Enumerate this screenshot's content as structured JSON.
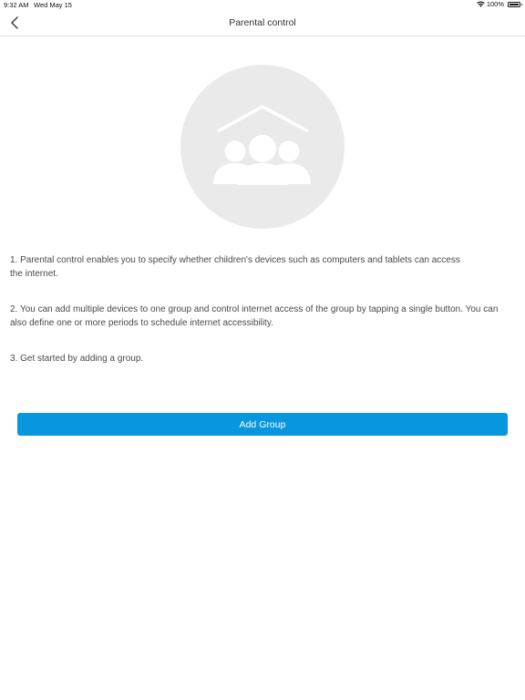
{
  "status_bar": {
    "time": "9:32 AM",
    "date": "Wed May 15",
    "battery": "100%"
  },
  "nav": {
    "title": "Parental control",
    "back_icon": "chevron-left-icon"
  },
  "hero": {
    "icon": "family-house-icon"
  },
  "instructions": [
    "1. Parental control enables you to specify whether children's devices such as computers and tablets can access the internet.",
    "2. You can add multiple devices to one group and control internet access of the group by tapping a single button. You can also define one or more periods to schedule internet accessibility.",
    "3. Get started by adding a group."
  ],
  "actions": {
    "add_group_label": "Add Group"
  },
  "colors": {
    "accent": "#0897de",
    "hero_bg": "#eaeaea"
  }
}
